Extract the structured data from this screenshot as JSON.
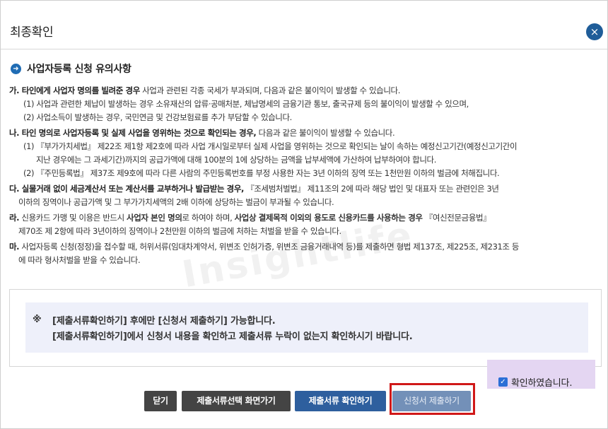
{
  "dialog": {
    "title": "최종확인",
    "close_icon": "×"
  },
  "section": {
    "title": "사업자등록 신청 유의사항"
  },
  "notice": {
    "ga": {
      "prefix": "가.",
      "lead": " 타인에게 사업자 명의를 빌려준 경우",
      "rest": " 사업과 관련된 각종 국세가 부과되며, 다음과 같은 불이익이 발생할 수 있습니다.",
      "subs": [
        "(1) 사업과 관련한 체납이 발생하는 경우 소유재산의 압류·공매처분, 체납명세의 금융기관 통보, 출국규제 등의 불이익이 발생할 수 있으며,",
        "(2) 사업소득이 발생하는 경우, 국민연금 및 건강보험료를 추가 부담할 수 있습니다."
      ]
    },
    "na": {
      "prefix": "나.",
      "lead": " 타인 명의로 사업자등록 및 실제 사업을 영위하는 것으로 확인되는 경우,",
      "rest": " 다음과 같은 불이익이 발생할 수 있습니다.",
      "sub1": "(1) 『부가가치세법』 제22조 제1항 제2호에 따라 사업 개시일로부터 실제 사업을 영위하는 것으로 확인되는 날이 속하는 예정신고기간(예정신고기간이",
      "sub1_cont": "지난 경우에는 그 과세기간)까지의 공급가액에 대해 100분의 1에 상당하는 금액을 납부세액에 가산하여 납부하여야 합니다.",
      "sub2": "(2) 『주민등록법』 제37조 제9호에 따라 다른 사람의 주민등록번호를 부정 사용한 자는 3년 이하의 징역 또는 1천만원 이하의 벌금에 처해집니다."
    },
    "da": {
      "prefix": "다.",
      "lead": " 실물거래 없이 세금계산서 또는 계산서를 교부하거나 발급받는 경우,",
      "rest": " 『조세범처벌법』 제11조의 2에 따라 해당 법인 및 대표자 또는 관련인은 3년",
      "cont": "이하의 징역이나 공급가액 및 그 부가가치세액의 2배 이하에 상당하는 벌금이 부과될 수 있습니다."
    },
    "ra": {
      "prefix": "라.",
      "t1": " 신용카드 가맹 및 이용은 반드시 ",
      "b1": "사업자 본인 명의",
      "t2": "로 하여야 하며, ",
      "b2": "사업상 결제목적 이외의 용도로 신용카드를 사용하는 경우",
      "t3": " 『여신전문금융법』",
      "cont": "제70조 제 2항에 따라 3년이하의 징역이나 2천만원 이하의 벌금에 처하는 처벌을 받을 수 있습니다."
    },
    "ma": {
      "prefix": "마.",
      "text": " 사업자등록 신청(정정)을 접수할 때, 허위서류(임대차계약서, 위변조 인허가증, 위변조 금융거래내역 등)를 제출하면 형법 제137조, 제225조, 제231조 등",
      "cont": "에 따라 형사처벌을 받을 수 있습니다."
    }
  },
  "watermark": "Insightlife",
  "confirm": {
    "mark": "※",
    "line1": "[제출서류확인하기] 후에만 [신청서 제출하기] 가능합니다.",
    "line2": "[제출서류확인하기]에서 신청서 내용을 확인하고 제출서류 누락이 없는지 확인하시기 바랍니다."
  },
  "checkbox": {
    "label": "확인하였습니다.",
    "checked": true,
    "check_glyph": "✓"
  },
  "buttons": {
    "close": "닫기",
    "select_screen": "제출서류선택 화면가기",
    "check_docs": "제출서류 확인하기",
    "submit": "신청서 제출하기"
  },
  "colors": {
    "primary_blue": "#2e5f9e",
    "dark_button": "#444444",
    "submit_button": "#7390b8",
    "highlight_red": "#d01818",
    "checkbox_area": "#e4d6f2",
    "notice_box": "#eef0fa"
  }
}
